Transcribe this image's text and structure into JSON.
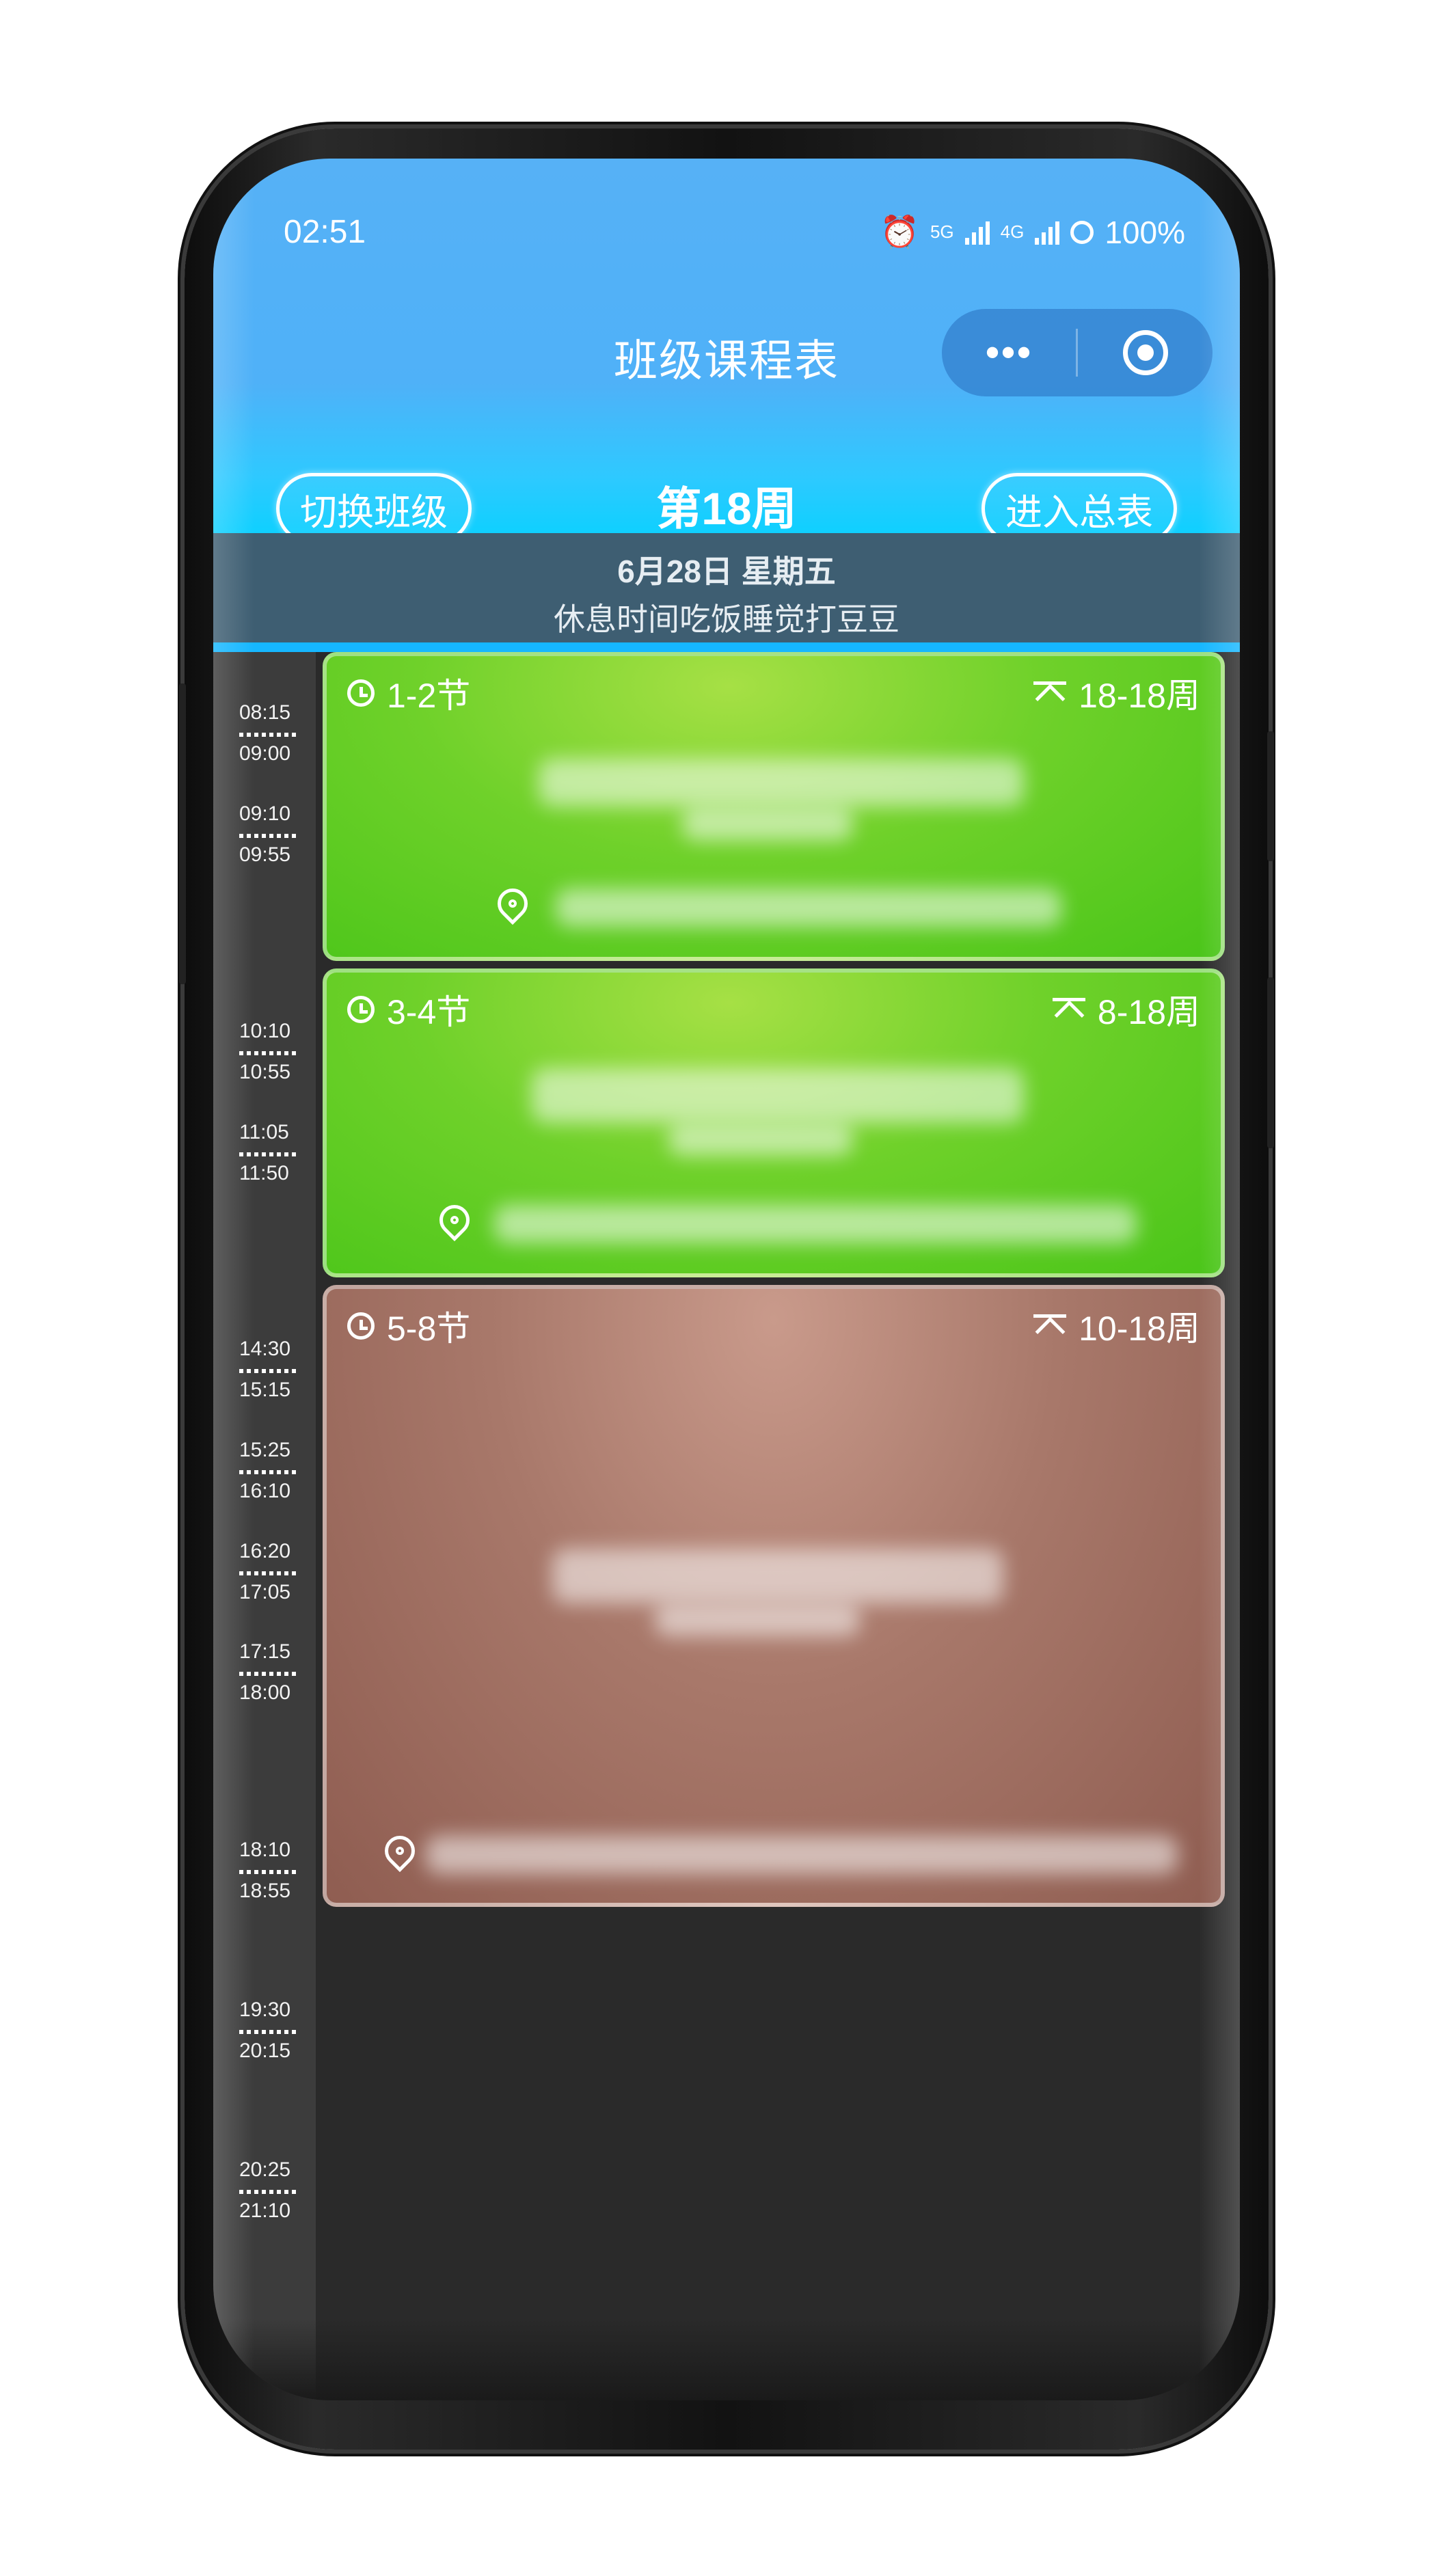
{
  "status_bar": {
    "time": "02:51",
    "network_5g": "5G",
    "network_4g": "4G",
    "battery": "100%"
  },
  "app": {
    "title": "班级课程表",
    "capsule_more": "•••"
  },
  "toolbar": {
    "switch_class_label": "切换班级",
    "week_label": "第18周",
    "enter_overview_label": "进入总表"
  },
  "date_bar": {
    "date": "6月28日 星期五",
    "rest_message": "休息时间吃饭睡觉打豆豆"
  },
  "timeline": [
    {
      "start": "08:15",
      "end": "09:00"
    },
    {
      "start": "09:10",
      "end": "09:55"
    },
    {
      "start": "10:10",
      "end": "10:55"
    },
    {
      "start": "11:05",
      "end": "11:50"
    },
    {
      "start": "14:30",
      "end": "15:15"
    },
    {
      "start": "15:25",
      "end": "16:10"
    },
    {
      "start": "16:20",
      "end": "17:05"
    },
    {
      "start": "17:15",
      "end": "18:00"
    },
    {
      "start": "18:10",
      "end": "18:55"
    },
    {
      "start": "19:30",
      "end": "20:15"
    },
    {
      "start": "20:25",
      "end": "21:10"
    }
  ],
  "courses": [
    {
      "sections": "1-2节",
      "weeks": "18-18周",
      "color": "#5fcf22"
    },
    {
      "sections": "3-4节",
      "weeks": "8-18周",
      "color": "#5fcf22"
    },
    {
      "sections": "5-8节",
      "weeks": "10-18周",
      "color": "#a8786a"
    }
  ],
  "icons": [
    "alarm-icon",
    "signal-icon",
    "battery-icon",
    "more-icon",
    "close-target-icon",
    "clock-icon",
    "collapse-icon",
    "location-pin-icon"
  ]
}
